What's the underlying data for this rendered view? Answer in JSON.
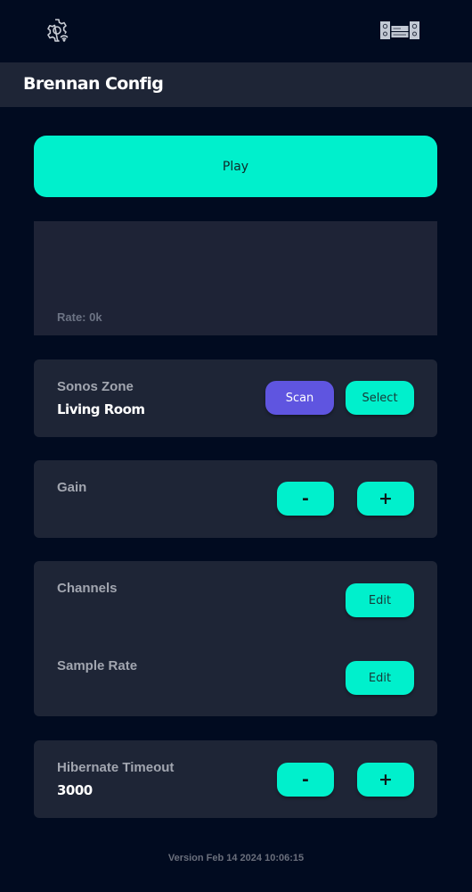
{
  "topbar": {
    "left_icon": "settings-wifi-icon",
    "right_icon": "stereo-system-icon"
  },
  "header": {
    "title": "Brennan Config"
  },
  "player": {
    "play_label": "Play",
    "rate_text": "Rate: 0k"
  },
  "settings": {
    "sonos_zone": {
      "label": "Sonos Zone",
      "value": "Living Room",
      "scan_label": "Scan",
      "select_label": "Select"
    },
    "gain": {
      "label": "Gain",
      "decrement_label": "-",
      "increment_label": "+"
    },
    "channels": {
      "label": "Channels",
      "edit_label": "Edit"
    },
    "sample_rate": {
      "label": "Sample Rate",
      "edit_label": "Edit"
    },
    "hibernate_timeout": {
      "label": "Hibernate Timeout",
      "value": "3000",
      "decrement_label": "-",
      "increment_label": "+"
    }
  },
  "footer": {
    "version": "Version Feb 14 2024 10:06:15"
  },
  "colors": {
    "background": "#010b20",
    "panel": "#1e2536",
    "accent": "#00f0cc",
    "scan": "#5f55e0"
  }
}
